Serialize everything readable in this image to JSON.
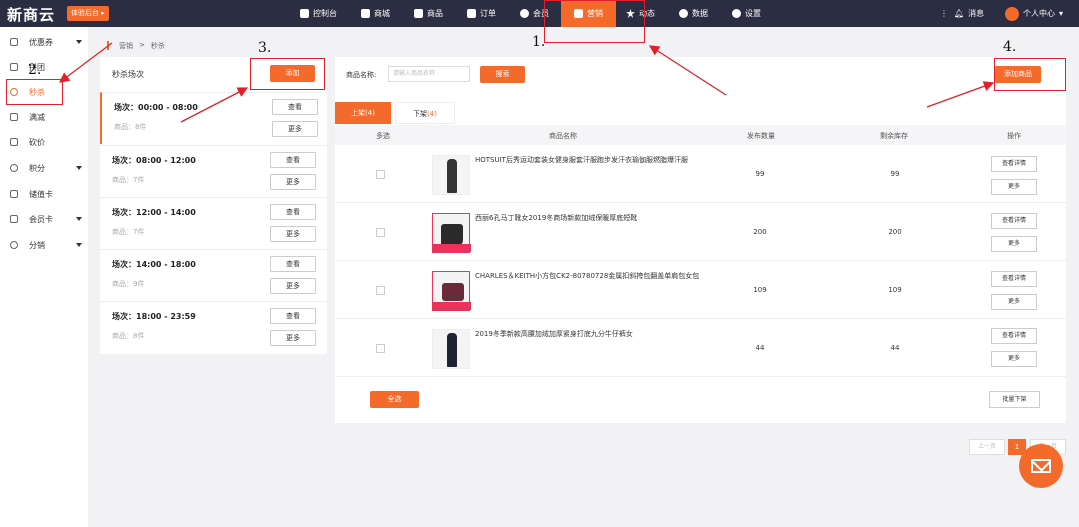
{
  "topbar": {
    "logo": "新商云",
    "trial": "体验后台 ▸",
    "nav": [
      {
        "label": "控制台",
        "icon": "home-icon"
      },
      {
        "label": "商城",
        "icon": "store-icon"
      },
      {
        "label": "商品",
        "icon": "goods-icon"
      },
      {
        "label": "订单",
        "icon": "order-icon"
      },
      {
        "label": "会员",
        "icon": "user-icon"
      },
      {
        "label": "营销",
        "icon": "marketing-icon"
      },
      {
        "label": "动态",
        "icon": "star-icon"
      },
      {
        "label": "数据",
        "icon": "chart-icon"
      },
      {
        "label": "设置",
        "icon": "gear-icon"
      }
    ],
    "message": "消息",
    "account": "个人中心"
  },
  "sidebar": {
    "items": [
      {
        "label": "优惠券",
        "caret": true
      },
      {
        "label": "拼团",
        "caret": false
      },
      {
        "label": "秒杀",
        "caret": false
      },
      {
        "label": "满减",
        "caret": false
      },
      {
        "label": "砍价",
        "caret": false
      },
      {
        "label": "积分",
        "caret": true
      },
      {
        "label": "储值卡",
        "caret": false
      },
      {
        "label": "会员卡",
        "caret": true
      },
      {
        "label": "分销",
        "caret": true
      }
    ]
  },
  "breadcrumb": {
    "parent": "营销",
    "sep": ">",
    "current": "秒杀"
  },
  "sessions": {
    "title": "秒杀场次",
    "add_label": "添加",
    "view_label": "查看",
    "more_label": "更多",
    "list": [
      {
        "time": "场次：00:00 - 08:00",
        "count": "商品：8件"
      },
      {
        "time": "场次：08:00 - 12:00",
        "count": "商品：7件"
      },
      {
        "time": "场次：12:00 - 14:00",
        "count": "商品：7件"
      },
      {
        "time": "场次：14:00 - 18:00",
        "count": "商品：9件"
      },
      {
        "time": "场次：18:00 - 23:59",
        "count": "商品：8件"
      }
    ]
  },
  "products": {
    "search_label": "商品名称:",
    "search_placeholder": "请输入商品名称",
    "search_btn": "搜索",
    "add_btn": "添加商品",
    "tab_on": "上架(4)",
    "tab_off_label": "下架",
    "tab_off_count": "(4)",
    "columns": {
      "select": "多选",
      "name": "商品名称",
      "qty": "发布数量",
      "stock": "剩余库存",
      "ops": "操作"
    },
    "detail_label": "查看详情",
    "more_label": "更多",
    "rows": [
      {
        "name": "HOTSUIT后秀运动套装女健身服套汗服跑步发汗衣瑜伽服燃脂爆汗服",
        "qty": "99",
        "stock": "99"
      },
      {
        "name": "西丽6孔马丁靴女2019冬商场新款加绒保暖厚底短靴",
        "qty": "200",
        "stock": "200"
      },
      {
        "name": "CHARLES＆KEITH小方包CK2-80780728金属扣斜挎包翻盖单肩包女包",
        "qty": "109",
        "stock": "109"
      },
      {
        "name": "2019冬季新款高腰加绒加厚紧身打底九分牛仔裤女",
        "qty": "44",
        "stock": "44"
      }
    ],
    "select_all": "全选",
    "bulk_off": "批量下架"
  },
  "pagination": {
    "prev": "上一页",
    "current": "1",
    "next": "下一页"
  },
  "annotations": {
    "n1": "1.",
    "n2": "2.",
    "n3": "3.",
    "n4": "4."
  },
  "colors": {
    "accent": "#f36a2a",
    "topbar": "#2b2d42",
    "annotation": "#e0202a"
  }
}
